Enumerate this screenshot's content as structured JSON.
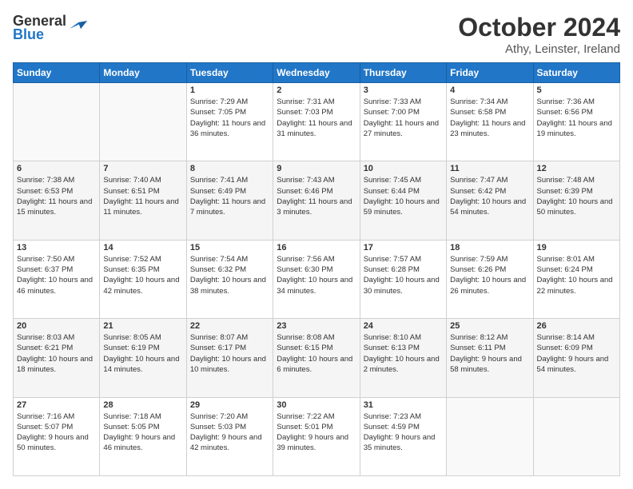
{
  "header": {
    "logo_general": "General",
    "logo_blue": "Blue",
    "title": "October 2024",
    "location": "Athy, Leinster, Ireland"
  },
  "weekdays": [
    "Sunday",
    "Monday",
    "Tuesday",
    "Wednesday",
    "Thursday",
    "Friday",
    "Saturday"
  ],
  "weeks": [
    [
      {
        "day": "",
        "info": ""
      },
      {
        "day": "",
        "info": ""
      },
      {
        "day": "1",
        "info": "Sunrise: 7:29 AM\nSunset: 7:05 PM\nDaylight: 11 hours and 36 minutes."
      },
      {
        "day": "2",
        "info": "Sunrise: 7:31 AM\nSunset: 7:03 PM\nDaylight: 11 hours and 31 minutes."
      },
      {
        "day": "3",
        "info": "Sunrise: 7:33 AM\nSunset: 7:00 PM\nDaylight: 11 hours and 27 minutes."
      },
      {
        "day": "4",
        "info": "Sunrise: 7:34 AM\nSunset: 6:58 PM\nDaylight: 11 hours and 23 minutes."
      },
      {
        "day": "5",
        "info": "Sunrise: 7:36 AM\nSunset: 6:56 PM\nDaylight: 11 hours and 19 minutes."
      }
    ],
    [
      {
        "day": "6",
        "info": "Sunrise: 7:38 AM\nSunset: 6:53 PM\nDaylight: 11 hours and 15 minutes."
      },
      {
        "day": "7",
        "info": "Sunrise: 7:40 AM\nSunset: 6:51 PM\nDaylight: 11 hours and 11 minutes."
      },
      {
        "day": "8",
        "info": "Sunrise: 7:41 AM\nSunset: 6:49 PM\nDaylight: 11 hours and 7 minutes."
      },
      {
        "day": "9",
        "info": "Sunrise: 7:43 AM\nSunset: 6:46 PM\nDaylight: 11 hours and 3 minutes."
      },
      {
        "day": "10",
        "info": "Sunrise: 7:45 AM\nSunset: 6:44 PM\nDaylight: 10 hours and 59 minutes."
      },
      {
        "day": "11",
        "info": "Sunrise: 7:47 AM\nSunset: 6:42 PM\nDaylight: 10 hours and 54 minutes."
      },
      {
        "day": "12",
        "info": "Sunrise: 7:48 AM\nSunset: 6:39 PM\nDaylight: 10 hours and 50 minutes."
      }
    ],
    [
      {
        "day": "13",
        "info": "Sunrise: 7:50 AM\nSunset: 6:37 PM\nDaylight: 10 hours and 46 minutes."
      },
      {
        "day": "14",
        "info": "Sunrise: 7:52 AM\nSunset: 6:35 PM\nDaylight: 10 hours and 42 minutes."
      },
      {
        "day": "15",
        "info": "Sunrise: 7:54 AM\nSunset: 6:32 PM\nDaylight: 10 hours and 38 minutes."
      },
      {
        "day": "16",
        "info": "Sunrise: 7:56 AM\nSunset: 6:30 PM\nDaylight: 10 hours and 34 minutes."
      },
      {
        "day": "17",
        "info": "Sunrise: 7:57 AM\nSunset: 6:28 PM\nDaylight: 10 hours and 30 minutes."
      },
      {
        "day": "18",
        "info": "Sunrise: 7:59 AM\nSunset: 6:26 PM\nDaylight: 10 hours and 26 minutes."
      },
      {
        "day": "19",
        "info": "Sunrise: 8:01 AM\nSunset: 6:24 PM\nDaylight: 10 hours and 22 minutes."
      }
    ],
    [
      {
        "day": "20",
        "info": "Sunrise: 8:03 AM\nSunset: 6:21 PM\nDaylight: 10 hours and 18 minutes."
      },
      {
        "day": "21",
        "info": "Sunrise: 8:05 AM\nSunset: 6:19 PM\nDaylight: 10 hours and 14 minutes."
      },
      {
        "day": "22",
        "info": "Sunrise: 8:07 AM\nSunset: 6:17 PM\nDaylight: 10 hours and 10 minutes."
      },
      {
        "day": "23",
        "info": "Sunrise: 8:08 AM\nSunset: 6:15 PM\nDaylight: 10 hours and 6 minutes."
      },
      {
        "day": "24",
        "info": "Sunrise: 8:10 AM\nSunset: 6:13 PM\nDaylight: 10 hours and 2 minutes."
      },
      {
        "day": "25",
        "info": "Sunrise: 8:12 AM\nSunset: 6:11 PM\nDaylight: 9 hours and 58 minutes."
      },
      {
        "day": "26",
        "info": "Sunrise: 8:14 AM\nSunset: 6:09 PM\nDaylight: 9 hours and 54 minutes."
      }
    ],
    [
      {
        "day": "27",
        "info": "Sunrise: 7:16 AM\nSunset: 5:07 PM\nDaylight: 9 hours and 50 minutes."
      },
      {
        "day": "28",
        "info": "Sunrise: 7:18 AM\nSunset: 5:05 PM\nDaylight: 9 hours and 46 minutes."
      },
      {
        "day": "29",
        "info": "Sunrise: 7:20 AM\nSunset: 5:03 PM\nDaylight: 9 hours and 42 minutes."
      },
      {
        "day": "30",
        "info": "Sunrise: 7:22 AM\nSunset: 5:01 PM\nDaylight: 9 hours and 39 minutes."
      },
      {
        "day": "31",
        "info": "Sunrise: 7:23 AM\nSunset: 4:59 PM\nDaylight: 9 hours and 35 minutes."
      },
      {
        "day": "",
        "info": ""
      },
      {
        "day": "",
        "info": ""
      }
    ]
  ]
}
